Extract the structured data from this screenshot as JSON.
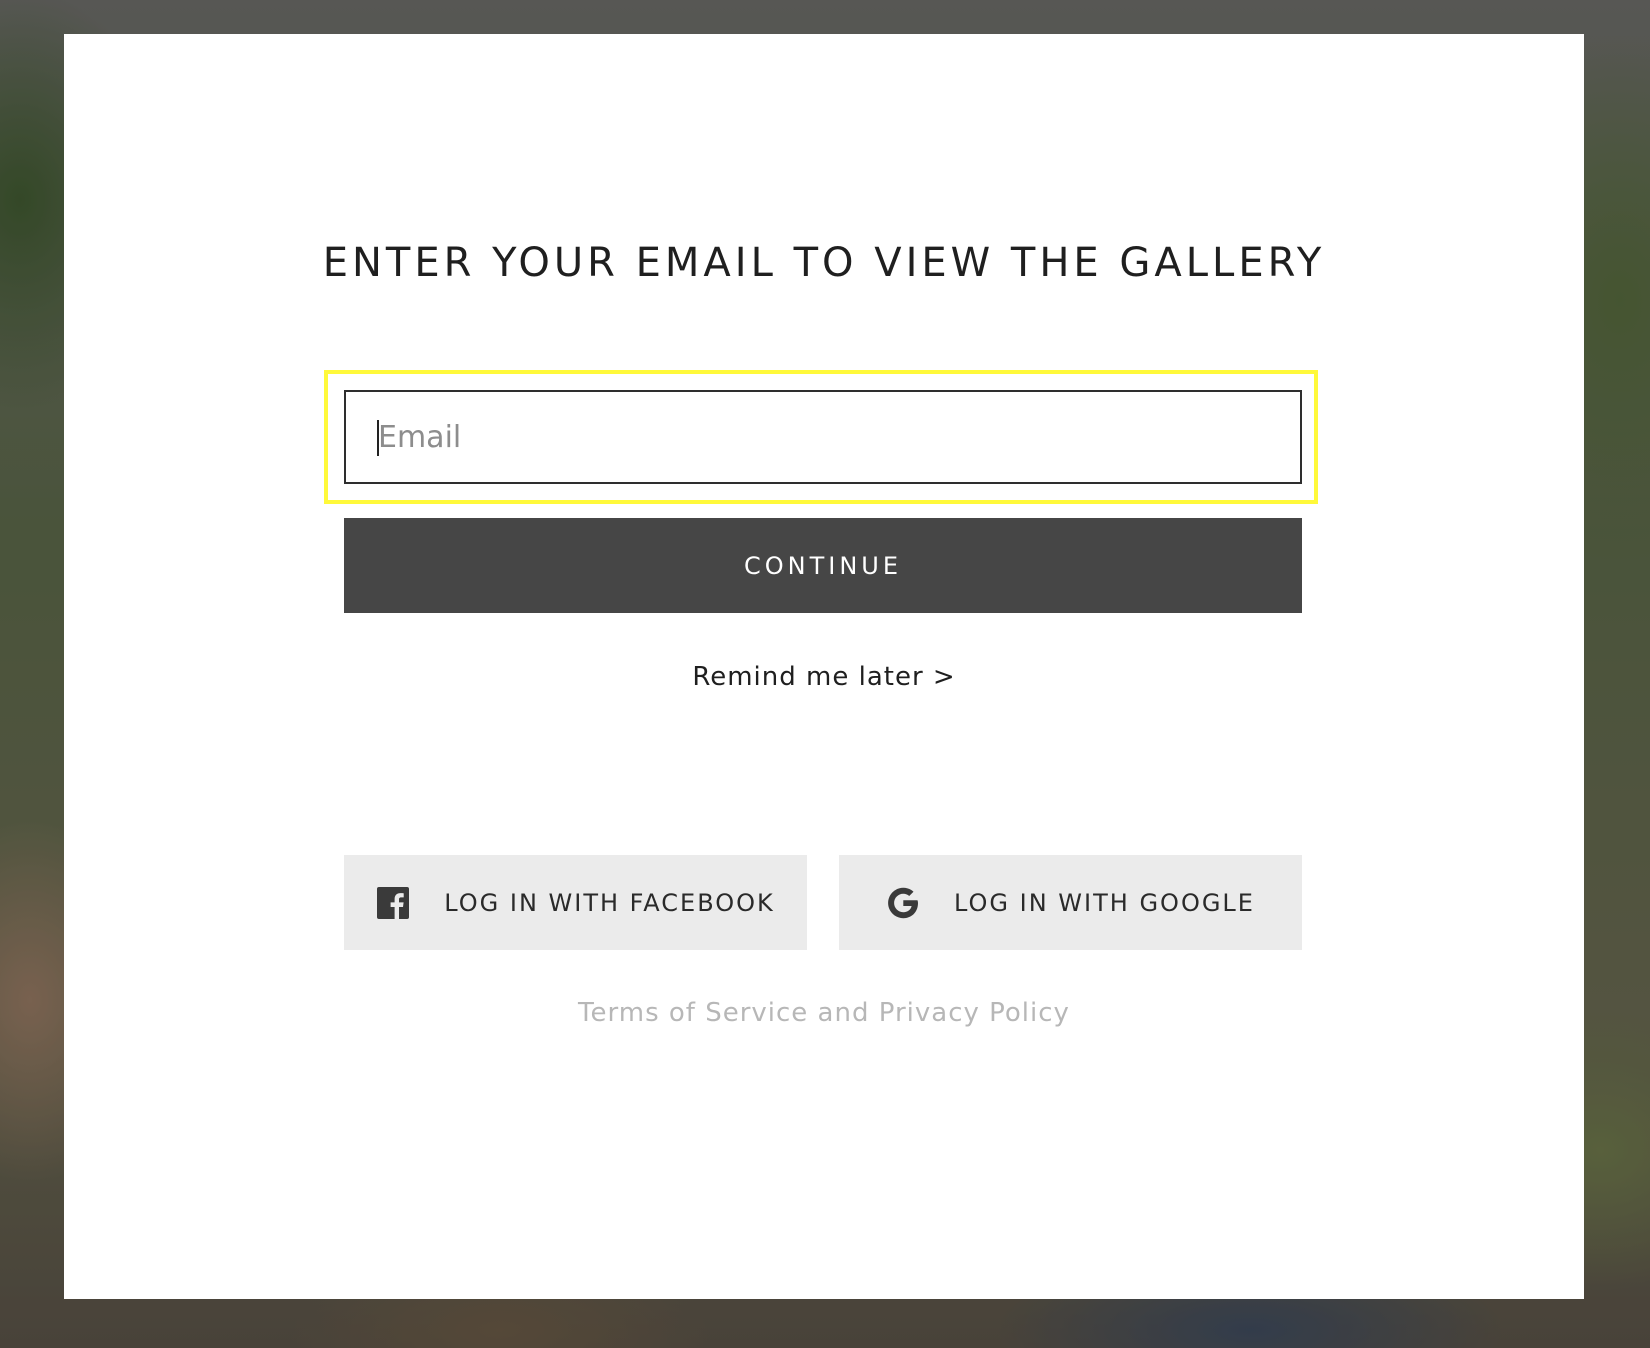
{
  "modal": {
    "title": "ENTER YOUR EMAIL TO VIEW THE GALLERY",
    "email": {
      "placeholder": "Email",
      "value": ""
    },
    "continue_label": "CONTINUE",
    "remind_label": "Remind me later >",
    "social": {
      "facebook_label": "LOG IN WITH FACEBOOK",
      "facebook_icon": "facebook-icon",
      "google_label": "LOG IN WITH GOOGLE",
      "google_icon": "google-icon"
    },
    "terms_label": "Terms of Service and Privacy Policy"
  },
  "colors": {
    "focus_ring": "#fff93a",
    "continue_bg": "#464646",
    "social_bg": "#ebebeb",
    "terms_text": "#b7b7b7"
  }
}
